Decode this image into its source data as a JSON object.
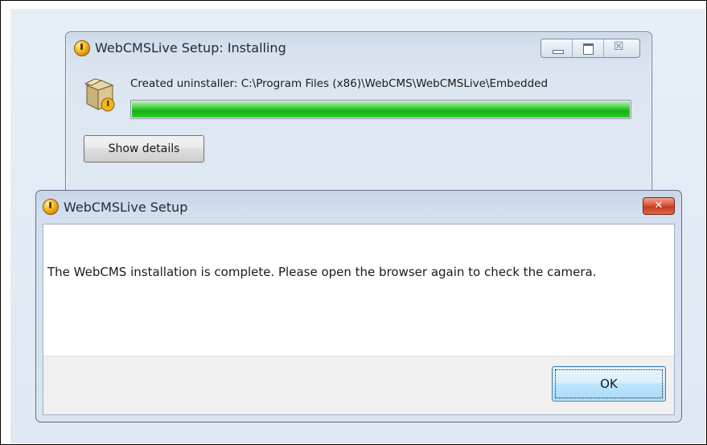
{
  "installer_window": {
    "title": "WebCMSLive Setup: Installing",
    "status": "Created uninstaller: C:\\Program Files (x86)\\WebCMS\\WebCMSLive\\Embedded",
    "progress_percent": 100,
    "show_details_label": "Show details",
    "controls": {
      "minimize_icon": "minimize-icon",
      "maximize_icon": "maximize-icon",
      "close_icon": "close-icon",
      "close_glyph": "☒"
    }
  },
  "setup_dialog": {
    "title": "WebCMSLive Setup",
    "message": "The  WebCMS installation is complete. Please open the browser again to check the camera.",
    "ok_label": "OK",
    "close_glyph": "✕"
  },
  "colors": {
    "progress_green": "#14b214",
    "close_red": "#c33a1f",
    "ok_focus_blue": "#3c7fb1"
  }
}
